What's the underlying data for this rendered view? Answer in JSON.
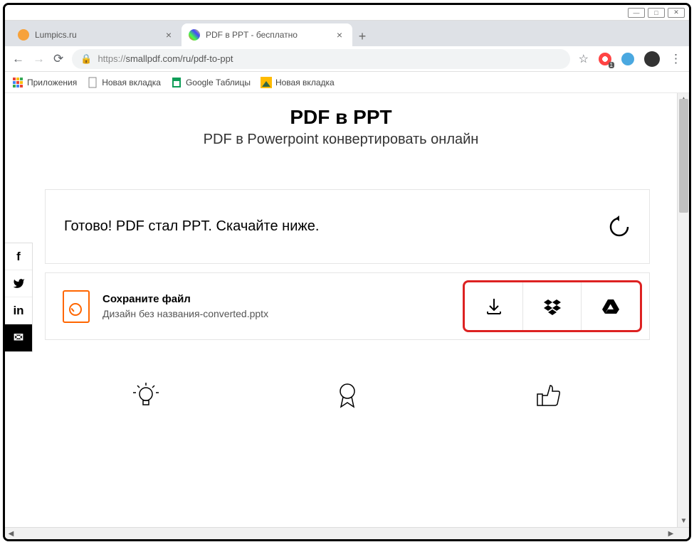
{
  "window": {
    "controls": {
      "min": "—",
      "max": "□",
      "close": "✕"
    }
  },
  "tabs": [
    {
      "title": "Lumpics.ru",
      "active": false,
      "icon_color": "#f7a23b"
    },
    {
      "title": "PDF в PPT - бесплатно",
      "active": true,
      "icon_color": "multi"
    }
  ],
  "newtab": "+",
  "addressbar": {
    "url_prefix": "https://",
    "url_rest": "smallpdf.com/ru/pdf-to-ppt"
  },
  "bookmarks": [
    {
      "label": "Приложения",
      "icon": "apps"
    },
    {
      "label": "Новая вкладка",
      "icon": "doc"
    },
    {
      "label": "Google Таблицы",
      "icon": "sheets"
    },
    {
      "label": "Новая вкладка",
      "icon": "img"
    }
  ],
  "page": {
    "title": "PDF в PPT",
    "subtitle": "PDF в Powerpoint конвертировать онлайн",
    "ready_message": "Готово! PDF стал PPT. Скачайте ниже.",
    "save_label": "Сохраните файл",
    "filename": "Дизайн без названия-converted.pptx"
  },
  "social": [
    "f",
    "t",
    "in",
    "m"
  ]
}
